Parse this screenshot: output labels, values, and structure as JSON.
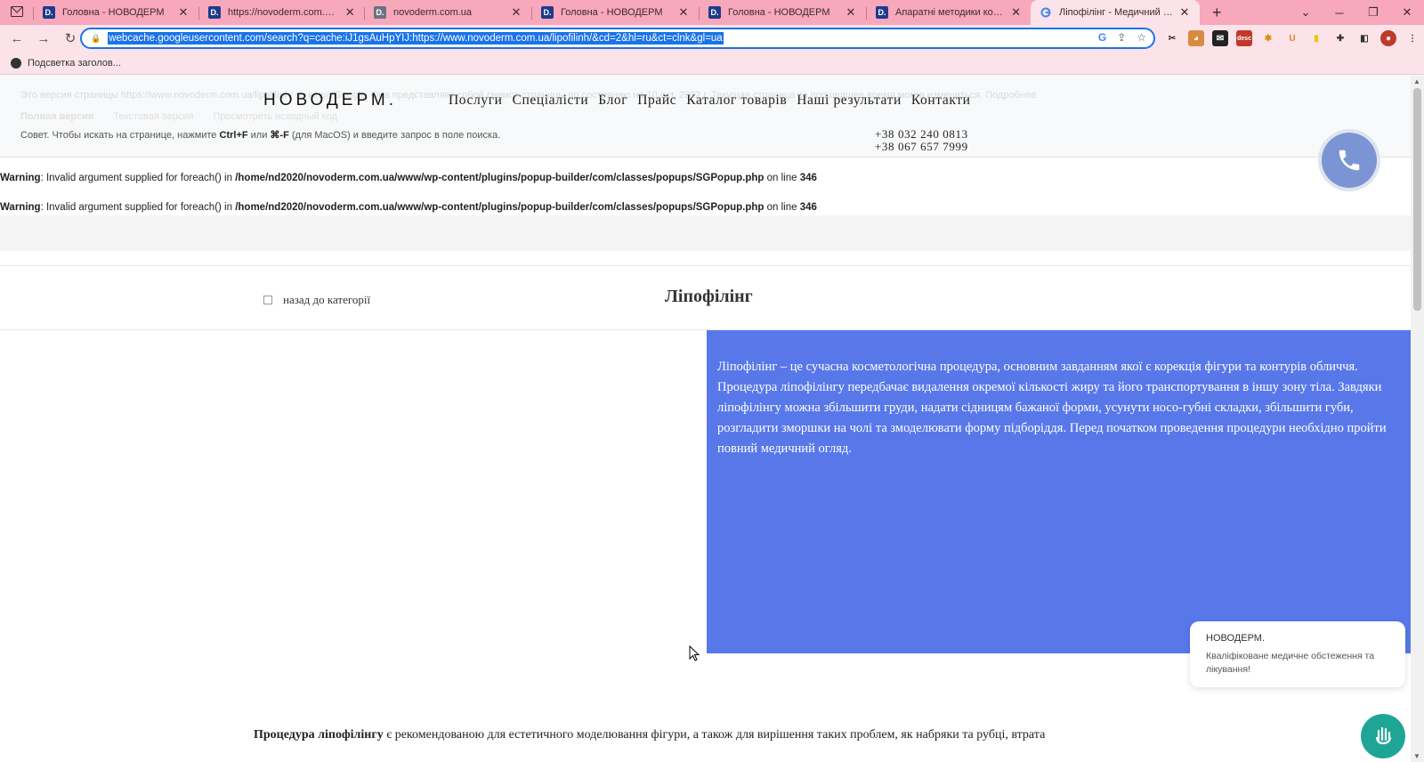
{
  "browser": {
    "tabs": [
      {
        "title": "",
        "favicon": "mail-icon",
        "pinned": true
      },
      {
        "title": "Головна - НОВОДЕРМ",
        "favicon": "D."
      },
      {
        "title": "https://novoderm.com.ua/robo",
        "favicon": "D."
      },
      {
        "title": "novoderm.com.ua",
        "favicon": "D."
      },
      {
        "title": "Головна - НОВОДЕРМ",
        "favicon": "D."
      },
      {
        "title": "Головна - НОВОДЕРМ",
        "favicon": "D."
      },
      {
        "title": "Апаратні методики косметоло",
        "favicon": "D."
      },
      {
        "title": "Ліпофілінг - Медичний центр",
        "favicon": "google-icon",
        "active": true
      }
    ],
    "new_tab": "+",
    "url": "webcache.googleusercontent.com/search?q=cache:iJ1gsAuHpYIJ:https://www.novoderm.com.ua/lipofilinh/&cd=2&hl=ru&ct=clnk&gl=ua",
    "bookmark": "Подсветка заголов..."
  },
  "cache": {
    "line1": "Это версия страницы https://www.novoderm.com.ua/lipofilinh/ из кеша Google. Она представляет собой снимок страницы по состоянию на 10 окт. 2022 г. Текущая страница за прошедшее время могла измениться. Подробнее",
    "links": [
      "Полная версия",
      "Текстовая версия",
      "Просмотреть исходный код"
    ],
    "hint_pre": "Совет. Чтобы искать на странице, нажмите ",
    "hint_key1": "Ctrl+F",
    "hint_mid": " или ",
    "hint_key2": "⌘-F",
    "hint_post": " (для MacOS) и введите запрос в поле поиска."
  },
  "site": {
    "logo": "НОВОДЕРМ.",
    "nav": [
      "Послуги",
      "Спеціалісти",
      "Блог",
      "Прайс",
      "Каталог товарів",
      "Наші результати",
      "Контакти"
    ],
    "phone1": "+38 032 240 0813",
    "phone2": "+38 067 657 7999"
  },
  "warnings": [
    {
      "label": "Warning",
      "text": ": Invalid argument supplied for foreach() in ",
      "path": "/home/nd2020/novoderm.com.ua/www/wp-content/plugins/popup-builder/com/classes/popups/SGPopup.php",
      "line_text": " on line ",
      "line": "346"
    },
    {
      "label": "Warning",
      "text": ": Invalid argument supplied for foreach() in ",
      "path": "/home/nd2020/novoderm.com.ua/www/wp-content/plugins/popup-builder/com/classes/popups/SGPopup.php",
      "line_text": " on line ",
      "line": "346"
    }
  ],
  "article": {
    "back_link": "назад до категорії",
    "title": "Ліпофілінг",
    "intro": "Ліпофілінг – це сучасна косметологічна процедура, основним завданням якої є корекція фігури та контурів обличчя. Процедура ліпофілінгу передбачає видалення окремої кількості жиру та його транспортування в іншу зону тіла. Завдяки ліпофілінгу можна збільшити груди, надати сідницям бажаної форми, усунути носо-губні складки, збільшити губи, розгладити зморшки на чолі та змоделювати форму підборіддя. Перед початком проведення процедури необхідно пройти повний медичний огляд.",
    "body_bold": "Процедура ліпофілінгу",
    "body_rest": " є рекомендованою для естетичного моделювання фігури, а також  для вирішення таких проблем, як набряки та рубці, втрата"
  },
  "chat": {
    "brand": "НОВОДЕРМ.",
    "message": "Кваліфіковане медичне обстеження та лікування!"
  },
  "colors": {
    "tabbar": "#f7a8bb",
    "panel": "#5878ea",
    "call": "#7b95d4",
    "chat": "#1fa596"
  }
}
